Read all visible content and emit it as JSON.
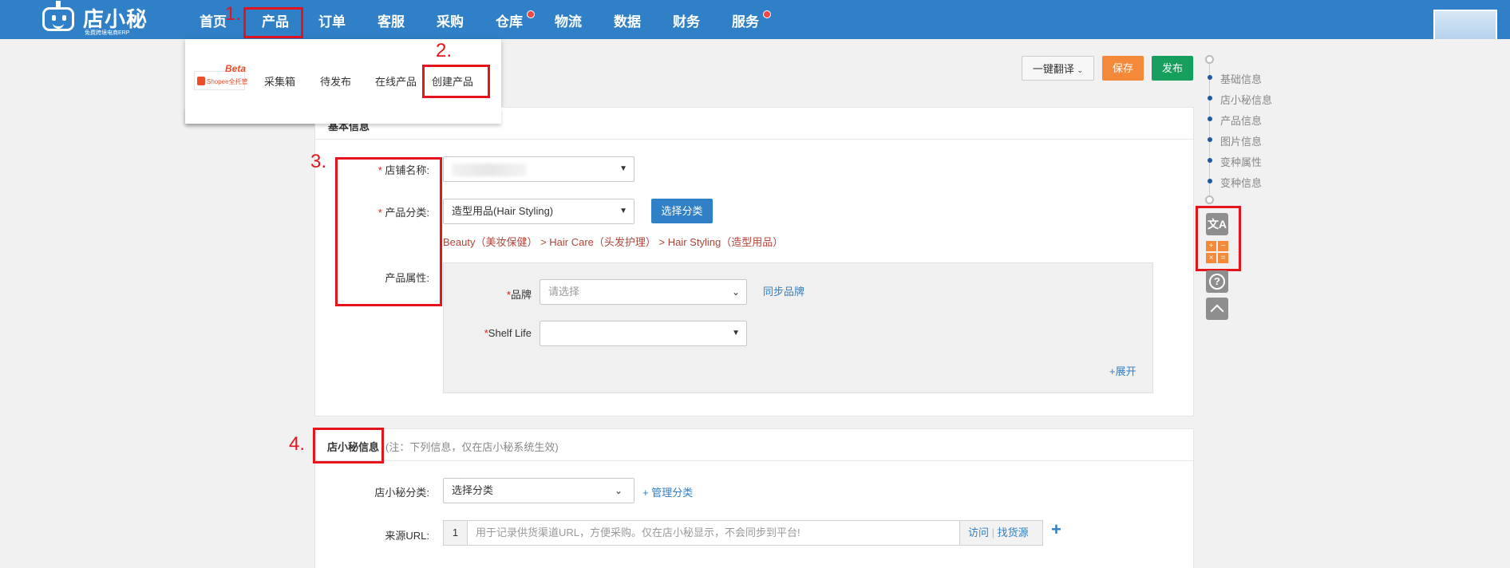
{
  "header": {
    "logo_name": "店小秘",
    "logo_sub": "免费跨境电商ERP",
    "nav": [
      "首页",
      "产品",
      "订单",
      "客服",
      "采购",
      "仓库",
      "物流",
      "数据",
      "财务",
      "服务"
    ]
  },
  "annotations": {
    "step1": "1.",
    "step2": "2.",
    "step3": "3.",
    "step4": "4."
  },
  "product_menu": {
    "beta_label": "Beta",
    "shopee_label": "Shopee全托管",
    "items": [
      "采集箱",
      "待发布",
      "在线产品",
      "创建产品"
    ]
  },
  "toolbar": {
    "translate_label": "一键翻译",
    "save_label": "保存",
    "publish_label": "发布"
  },
  "basic_info": {
    "section_title": "基本信息",
    "shop_label": "店铺名称:",
    "category_label": "产品分类:",
    "category_value": "造型用品(Hair Styling)",
    "choose_category_label": "选择分类",
    "category_path": "Beauty（美妆保健） > Hair Care（头发护理） > Hair Styling（造型用品）",
    "attributes_label": "产品属性:",
    "brand_label": "品牌",
    "brand_placeholder": "请选择",
    "sync_brand_label": "同步品牌",
    "shelf_life_label": "Shelf Life",
    "expand_label": "+展开"
  },
  "dxm_info": {
    "section_title": "店小秘信息",
    "section_note": "(注：下列信息，仅在店小秘系统生效)",
    "category_label": "店小秘分类:",
    "category_value": "选择分类",
    "manage_category_label": "+ 管理分类",
    "source_url_label": "来源URL:",
    "url_index": "1",
    "url_placeholder": "用于记录供货渠道URL，方便采购。仅在店小秘显示，不会同步到平台!",
    "visit_label": "访问",
    "find_source_label": "找货源"
  },
  "anchor_nav": [
    "基础信息",
    "店小秘信息",
    "产品信息",
    "图片信息",
    "变种属性",
    "变种信息"
  ],
  "colors": {
    "header_bg": "#2f80c6",
    "save": "#f5893a",
    "publish": "#17a05d",
    "annotation_red": "#e3141b"
  }
}
